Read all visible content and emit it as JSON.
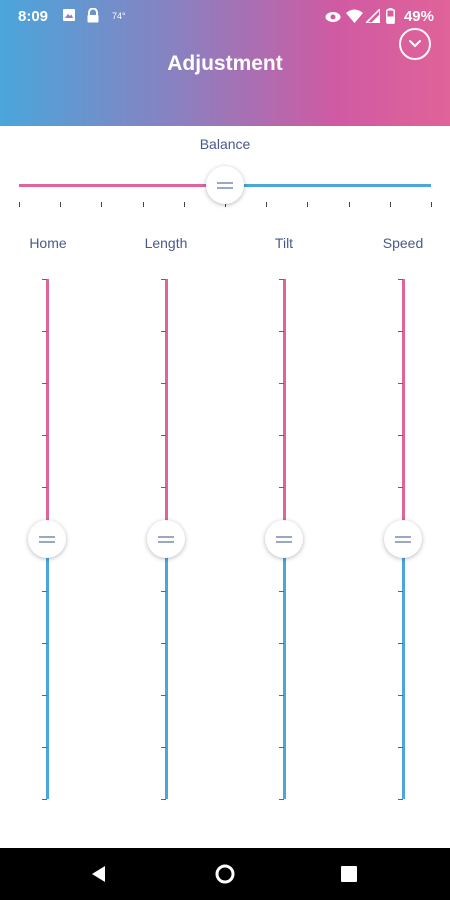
{
  "status_bar": {
    "time": "8:09",
    "temperature": "74°",
    "battery": "49%",
    "icons": [
      "image-icon",
      "lock-icon",
      "eye-icon",
      "wifi-icon",
      "signal-icon",
      "battery-icon"
    ]
  },
  "header": {
    "title": "Adjustment",
    "collapse_icon": "chevron-down-icon",
    "gradient": [
      "#4aa6db",
      "#8b80c0",
      "#d05aa2",
      "#e06399"
    ]
  },
  "balance": {
    "label": "Balance",
    "value": 0.5
  },
  "sliders": [
    {
      "label": "Home",
      "value": 0.5
    },
    {
      "label": "Length",
      "value": 0.5
    },
    {
      "label": "Tilt",
      "value": 0.5
    },
    {
      "label": "Speed",
      "value": 0.5
    }
  ],
  "colors": {
    "pink": "#e06399",
    "blue": "#4aa6db",
    "label": "#4a5a8a"
  },
  "nav_bar": {
    "icons": [
      "back-icon",
      "home-icon",
      "recents-icon"
    ]
  }
}
